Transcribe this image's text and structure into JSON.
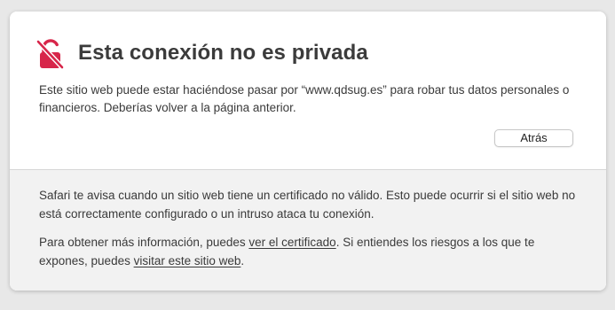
{
  "warning": {
    "icon": "broken-lock-icon",
    "icon_color": "#d7264a",
    "title": "Esta conexión no es privada",
    "description": "Este sitio web puede estar haciéndose pasar por “www.qdsug.es” para robar tus datos personales o financieros. Deberías volver a la página anterior.",
    "back_button": "Atrás"
  },
  "details": {
    "paragraph1": "Safari te avisa cuando un sitio web tiene un certificado no válido. Esto puede ocurrir si el sitio web no está correctamente configurado o un intruso ataca tu conexión.",
    "paragraph2_prefix": "Para obtener más información, puedes ",
    "view_certificate_link": "ver el certificado",
    "paragraph2_middle": ". Si entiendes los riesgos a los que te expones, puedes ",
    "visit_site_link": "visitar este sitio web",
    "paragraph2_suffix": "."
  }
}
